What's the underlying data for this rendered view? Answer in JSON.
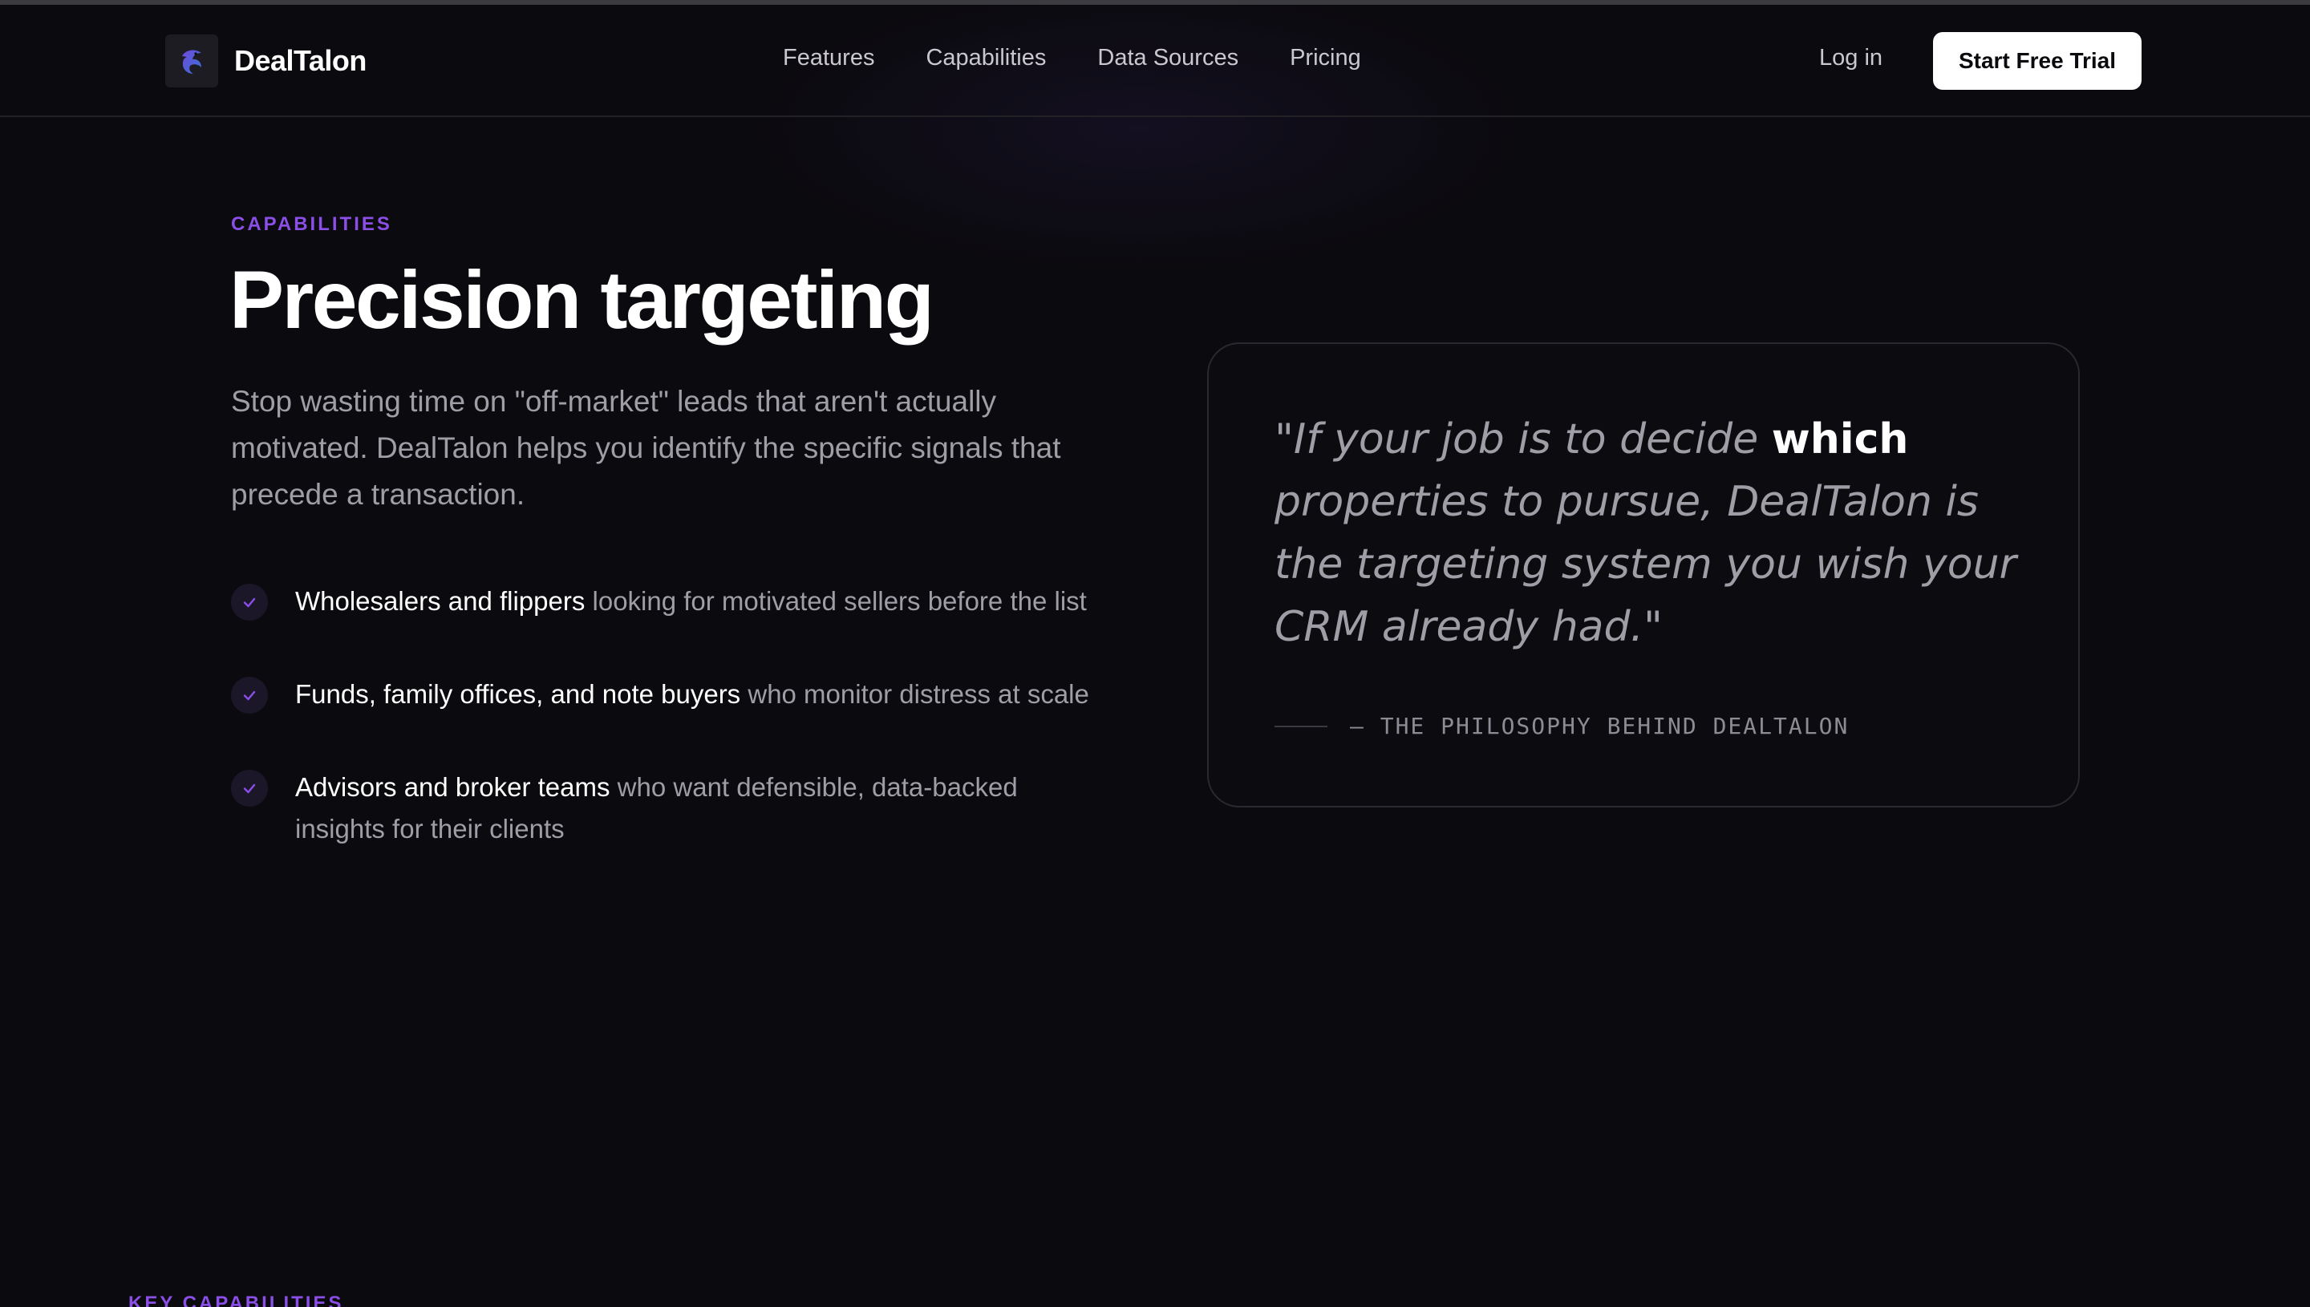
{
  "nav": {
    "brand": "DealTalon",
    "links": [
      "Features",
      "Capabilities",
      "Data Sources",
      "Pricing"
    ],
    "login": "Log in",
    "cta": "Start Free Trial"
  },
  "hero": {
    "eyebrow": "CAPABILITIES",
    "title": "Precision targeting",
    "lead": "Stop wasting time on \"off-market\" leads that aren't actually motivated. DealTalon helps you identify the specific signals that precede a transaction.",
    "items": [
      {
        "strong": "Wholesalers and flippers",
        "rest": " looking for motivated sellers before the list"
      },
      {
        "strong": "Funds, family offices, and note buyers",
        "rest": " who monitor distress at scale"
      },
      {
        "strong": "Advisors and broker teams",
        "rest": " who want defensible, data-backed insights for their clients"
      }
    ]
  },
  "quote": {
    "before": "\"If your job is to decide ",
    "emphasis": "which",
    "after": " properties to pursue, DealTalon is the targeting system you wish your CRM already had.\"",
    "attribution": "— THE PHILOSOPHY BEHIND DEALTALON"
  },
  "next_section": {
    "eyebrow": "KEY CAPABILITIES"
  },
  "icons": {
    "logo": "talon-bird-logo",
    "check": "check-icon"
  },
  "colors": {
    "accent": "#8b4fe8",
    "background": "#0b0a0e",
    "muted_text": "#9f9ea6"
  }
}
